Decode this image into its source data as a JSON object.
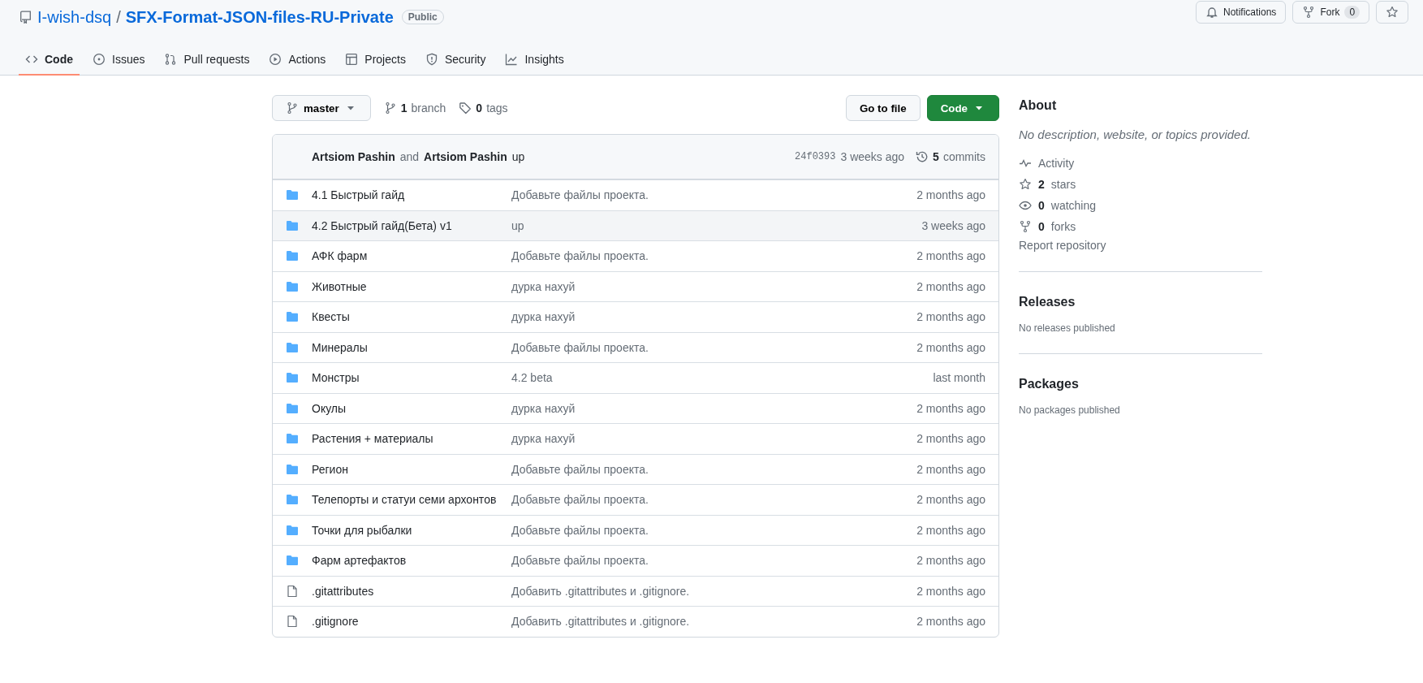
{
  "repo": {
    "owner": "I-wish-dsq",
    "separator": "/",
    "name": "SFX-Format-JSON-files-RU-Private",
    "visibility": "Public"
  },
  "actions": [
    {
      "kind": "notifications",
      "label": "Notifications"
    },
    {
      "kind": "fork",
      "label": "Fork",
      "count": "0"
    },
    {
      "kind": "star"
    }
  ],
  "tabs": [
    {
      "label": "Code",
      "selected": true
    },
    {
      "label": "Issues",
      "selected": false
    },
    {
      "label": "Pull requests",
      "selected": false
    },
    {
      "label": "Actions",
      "selected": false
    },
    {
      "label": "Projects",
      "selected": false
    },
    {
      "label": "Security",
      "selected": false
    },
    {
      "label": "Insights",
      "selected": false
    }
  ],
  "branch_bar": {
    "branch": "master",
    "branches_count": "1",
    "branches_label": "branch",
    "tags_count": "0",
    "tags_label": "tags",
    "go_to_file": "Go to file",
    "code_button": "Code"
  },
  "latest_commit": {
    "author": "Artsiom Pashin",
    "joiner": "and",
    "coauthor": "Artsiom Pashin",
    "message": "up",
    "sha": "24f0393",
    "time": "3 weeks ago",
    "commits_count": "5",
    "commits_label": "commits"
  },
  "files": [
    {
      "kind": "folder",
      "name": "4.1 Быстрый гайд",
      "message": "Добавьте файлы проекта.",
      "time": "2 months ago",
      "selected": false
    },
    {
      "kind": "folder",
      "name": "4.2 Быстрый гайд(Бета) v1",
      "message": "up",
      "time": "3 weeks ago",
      "selected": true
    },
    {
      "kind": "folder",
      "name": "АФК фарм",
      "message": "Добавьте файлы проекта.",
      "time": "2 months ago",
      "selected": false
    },
    {
      "kind": "folder",
      "name": "Животные",
      "message": "дурка нахуй",
      "time": "2 months ago",
      "selected": false
    },
    {
      "kind": "folder",
      "name": "Квесты",
      "message": "дурка нахуй",
      "time": "2 months ago",
      "selected": false
    },
    {
      "kind": "folder",
      "name": "Минералы",
      "message": "Добавьте файлы проекта.",
      "time": "2 months ago",
      "selected": false
    },
    {
      "kind": "folder",
      "name": "Монстры",
      "message": "4.2 beta",
      "time": "last month",
      "selected": false
    },
    {
      "kind": "folder",
      "name": "Окулы",
      "message": "дурка нахуй",
      "time": "2 months ago",
      "selected": false
    },
    {
      "kind": "folder",
      "name": "Растения + материалы",
      "message": "дурка нахуй",
      "time": "2 months ago",
      "selected": false
    },
    {
      "kind": "folder",
      "name": "Регион",
      "message": "Добавьте файлы проекта.",
      "time": "2 months ago",
      "selected": false
    },
    {
      "kind": "folder",
      "name": "Телепорты и статуи семи архонтов",
      "message": "Добавьте файлы проекта.",
      "time": "2 months ago",
      "selected": false
    },
    {
      "kind": "folder",
      "name": "Точки для рыбалки",
      "message": "Добавьте файлы проекта.",
      "time": "2 months ago",
      "selected": false
    },
    {
      "kind": "folder",
      "name": "Фарм артефактов",
      "message": "Добавьте файлы проекта.",
      "time": "2 months ago",
      "selected": false
    },
    {
      "kind": "file",
      "name": ".gitattributes",
      "message": "Добавить .gitattributes и .gitignore.",
      "time": "2 months ago",
      "selected": false
    },
    {
      "kind": "file",
      "name": ".gitignore",
      "message": "Добавить .gitattributes и .gitignore.",
      "time": "2 months ago",
      "selected": false
    }
  ],
  "about": {
    "title": "About",
    "description": "No description, website, or topics provided.",
    "stats": [
      {
        "label": "Activity"
      },
      {
        "count": "2",
        "label": "stars"
      },
      {
        "count": "0",
        "label": "watching"
      },
      {
        "count": "0",
        "label": "forks"
      }
    ],
    "report": "Report repository"
  },
  "releases": {
    "title": "Releases",
    "note": "No releases published"
  },
  "packages": {
    "title": "Packages",
    "note": "No packages published"
  }
}
